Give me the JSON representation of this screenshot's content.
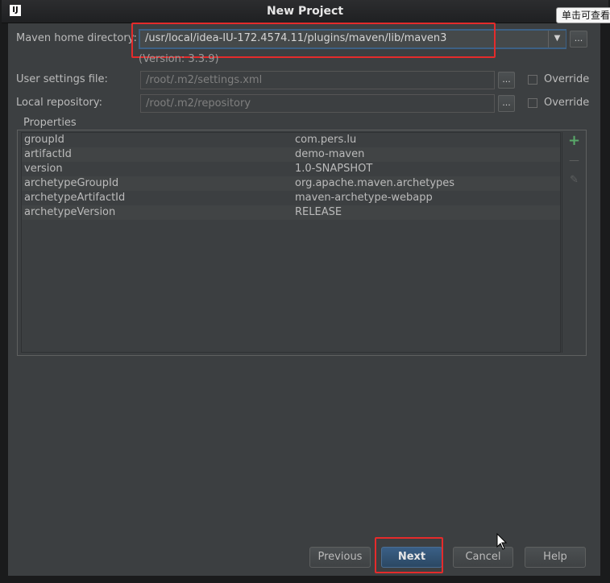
{
  "window": {
    "title": "New Project",
    "app_icon_text": "IJ",
    "tooltip": "单击可查看"
  },
  "form": {
    "maven_home": {
      "label": "Maven home directory:",
      "value": "/usr/local/idea-IU-172.4574.11/plugins/maven/lib/maven3",
      "dropdown_glyph": "▼",
      "browse_glyph": "...",
      "version_note": "(Version: 3.3.9)"
    },
    "user_settings": {
      "label": "User settings file:",
      "value": "/root/.m2/settings.xml",
      "browse_glyph": "...",
      "override_label": "Override",
      "override_checked": false
    },
    "local_repository": {
      "label": "Local repository:",
      "value": "/root/.m2/repository",
      "browse_glyph": "...",
      "override_label": "Override",
      "override_checked": false
    }
  },
  "properties": {
    "title": "Properties",
    "rows": [
      {
        "key": "groupId",
        "value": "com.pers.lu"
      },
      {
        "key": "artifactId",
        "value": "demo-maven"
      },
      {
        "key": "version",
        "value": "1.0-SNAPSHOT"
      },
      {
        "key": "archetypeGroupId",
        "value": "org.apache.maven.archetypes"
      },
      {
        "key": "archetypeArtifactId",
        "value": "maven-archetype-webapp"
      },
      {
        "key": "archetypeVersion",
        "value": "RELEASE"
      }
    ],
    "actions": {
      "add": "+",
      "remove": "—",
      "edit": "✎"
    }
  },
  "buttons": {
    "previous": "Previous",
    "next": "Next",
    "cancel": "Cancel",
    "help": "Help"
  },
  "colors": {
    "dialog_bg": "#3c3f41",
    "highlight": "#e52b2b",
    "accent": "#3d6185",
    "add_green": "#59a869"
  }
}
